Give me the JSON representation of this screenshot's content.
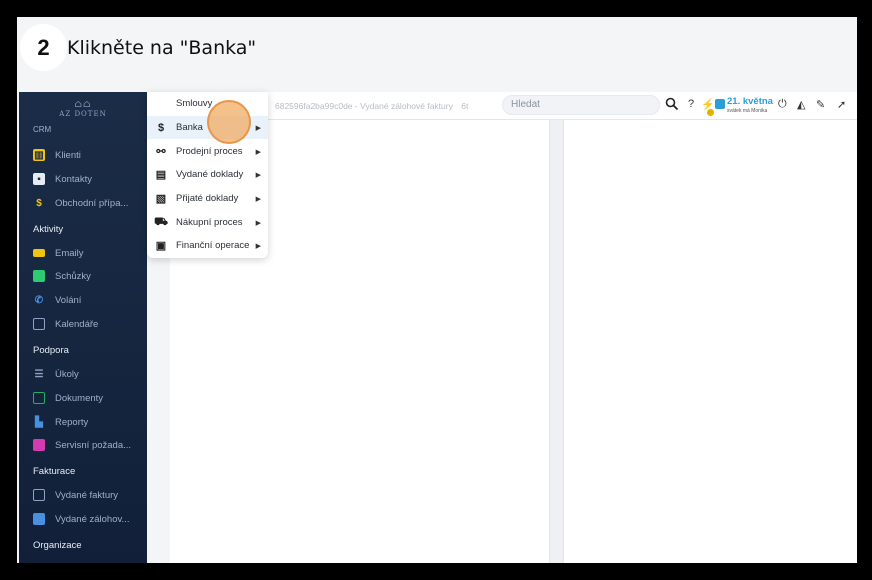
{
  "step": {
    "number": "2",
    "instruction": "Klikněte na \"Banka\""
  },
  "logo": {
    "text": "AZ DOTEN"
  },
  "sidebar": {
    "partial_top": "CRM",
    "sections": [
      {
        "label": "Aktivity"
      },
      {
        "label": "Podpora"
      },
      {
        "label": "Fakturace"
      },
      {
        "label": "Organizace"
      }
    ],
    "items": [
      {
        "label": "Klienti",
        "icon": "building-icon",
        "color": "#f1c40f"
      },
      {
        "label": "Kontakty",
        "icon": "contact-card-icon",
        "color": "#e7ecf4"
      },
      {
        "label": "Obchodní přípa...",
        "icon": "dollar-icon",
        "color": "#f1c40f"
      },
      {
        "label": "Emaily",
        "icon": "envelope-icon",
        "color": "#f1c40f"
      },
      {
        "label": "Schůzky",
        "icon": "calendar-check-icon",
        "color": "#2ecc71"
      },
      {
        "label": "Volání",
        "icon": "phone-icon",
        "color": "#4a90e2"
      },
      {
        "label": "Kalendáře",
        "icon": "calendar-icon",
        "color": "#8ea3c4"
      },
      {
        "label": "Úkoly",
        "icon": "task-list-icon",
        "color": "#8ea3c4"
      },
      {
        "label": "Dokumenty",
        "icon": "document-icon",
        "color": "#27ae60"
      },
      {
        "label": "Reporty",
        "icon": "chart-icon",
        "color": "#4a90e2"
      },
      {
        "label": "Servisní požada...",
        "icon": "briefcase-icon",
        "color": "#d63ab3"
      },
      {
        "label": "Vydané faktury",
        "icon": "invoice-icon",
        "color": "#8ea3c4"
      },
      {
        "label": "Vydané zálohov...",
        "icon": "advance-invoice-icon",
        "color": "#4a90e2"
      }
    ]
  },
  "topbar": {
    "breadcrumb": "682596fa2ba99c0de - Vydané zálohové faktury",
    "breadcrumb_cut": "6t",
    "search_placeholder": "Hledat",
    "date": "21. května",
    "date_sub": "svátek má Monika"
  },
  "dropdown": {
    "items": [
      {
        "label": "Smlouvy",
        "icon": "",
        "has_submenu": false
      },
      {
        "label": "Banka",
        "icon": "$",
        "has_submenu": true
      },
      {
        "label": "Prodejní proces",
        "icon": "handshake-icon",
        "has_submenu": true
      },
      {
        "label": "Vydané doklady",
        "icon": "document-out-icon",
        "has_submenu": true
      },
      {
        "label": "Přijaté doklady",
        "icon": "document-in-icon",
        "has_submenu": true
      },
      {
        "label": "Nákupní proces",
        "icon": "cart-icon",
        "has_submenu": true
      },
      {
        "label": "Finanční operace",
        "icon": "money-icon",
        "has_submenu": true
      }
    ]
  },
  "colors": {
    "accent": "#2a9fd6",
    "sidebar_bg": "#1b2c47",
    "highlight": "#f1a65a"
  }
}
